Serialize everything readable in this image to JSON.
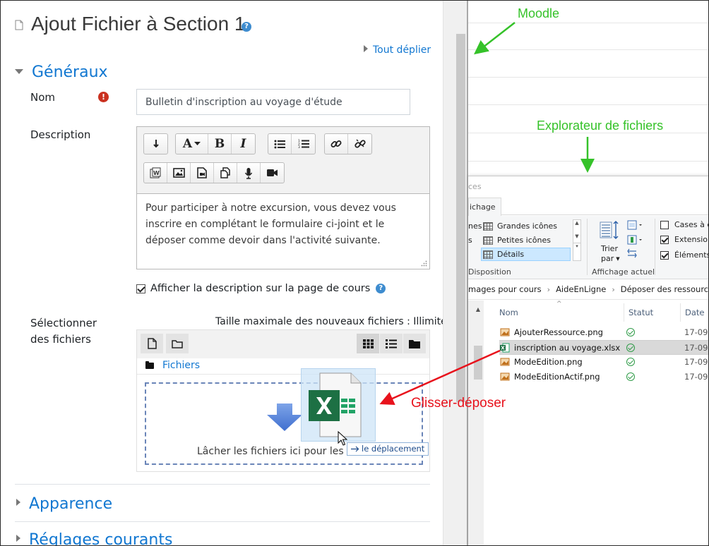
{
  "moodle": {
    "page_title": "Ajout Fichier à Section 1",
    "help_glyph": "?",
    "expand_all": "Tout déplier",
    "section_general": "Généraux",
    "section_appearance": "Apparence",
    "section_common": "Réglages courants",
    "name_label": "Nom",
    "required_glyph": "!",
    "name_value": "Bulletin d'inscription au voyage d'étude",
    "description_label": "Description",
    "description_text": "Pour participer à notre excursion, vous devez vous inscrire en complétant le formulaire ci-joint et le déposer comme devoir dans l'activité suivante.",
    "show_description_label": "Afficher la description sur la page de cours",
    "show_description_checked": true,
    "files_label": "Sélectionner des fichiers",
    "max_size": "Taille maximale des nouveaux fichiers : Illimité",
    "files_path": "Fichiers",
    "drop_text": "Lâcher les fichiers ici pour les en",
    "drag_tooltip": "le déplacement",
    "toolbar_row1": [
      "paragraph-icon",
      "text-style-icon",
      "bold-icon",
      "italic-icon",
      "unordered-list-icon",
      "ordered-list-icon",
      "link-icon",
      "unlink-icon"
    ],
    "toolbar_row2": [
      "word-paste-icon",
      "image-icon",
      "media-icon",
      "manage-files-icon",
      "record-audio-icon",
      "record-video-icon"
    ]
  },
  "annotations": {
    "moodle": "Moodle",
    "explorer": "Explorateur de fichiers",
    "drag_drop": "Glisser-déposer",
    "color_green": "#35c229",
    "color_red": "#e8121c"
  },
  "explorer": {
    "title_fragment": "ces",
    "tab_display": "ichage",
    "ribbon_large_icons": "Grandes icônes",
    "ribbon_small_icons": "Petites icônes",
    "ribbon_details": "Détails",
    "ribbon_frag_1": "nes",
    "ribbon_frag_2": "s",
    "ribbon_sort": "Trier",
    "ribbon_sort_by": "par",
    "ribbon_caption_layout": "Disposition",
    "ribbon_caption_view": "Affichage actuel",
    "ribbon_checkboxes": "Cases à c",
    "ribbon_extensions": "Extension",
    "ribbon_items": "Éléments",
    "breadcrumb": [
      "mages pour cours",
      "AideEnLigne",
      "Déposer des ressources"
    ],
    "col_name": "Nom",
    "col_status": "Statut",
    "col_date": "Date",
    "files": [
      {
        "name": "AjouterRessource.png",
        "date": "17-09-",
        "type": "png"
      },
      {
        "name": "inscription au voyage.xlsx",
        "date": "17-09-",
        "type": "xlsx"
      },
      {
        "name": "ModeEdition.png",
        "date": "17-09-",
        "type": "png"
      },
      {
        "name": "ModeEditionActif.png",
        "date": "17-09-",
        "type": "png"
      }
    ]
  }
}
